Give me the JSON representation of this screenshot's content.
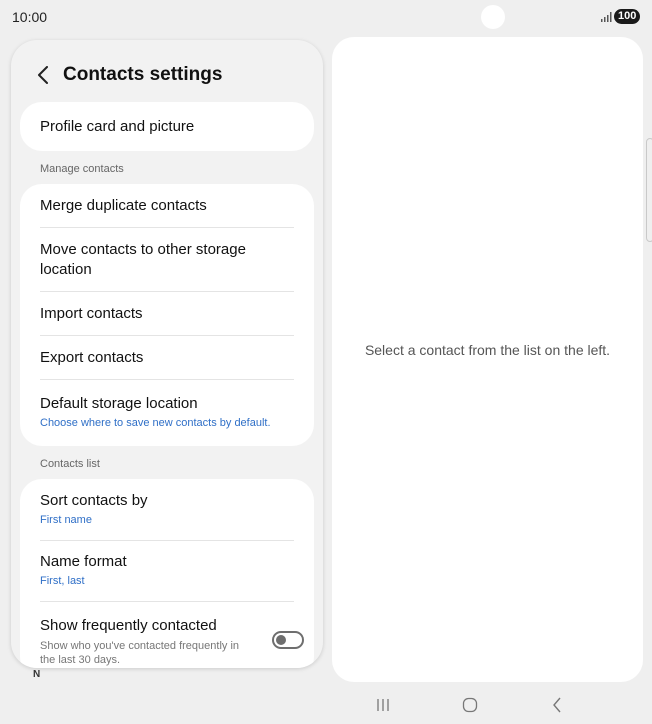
{
  "status_bar": {
    "time": "10:00",
    "battery": "100",
    "signal_icon": "signal-bars-icon"
  },
  "header": {
    "title": "Contacts settings",
    "back_icon": "chevron-left-icon"
  },
  "profile_card": {
    "label": "Profile card and picture"
  },
  "manage_contacts": {
    "section_label": "Manage contacts",
    "items": [
      {
        "label": "Merge duplicate contacts"
      },
      {
        "label": "Move contacts to other storage location"
      },
      {
        "label": "Import contacts"
      },
      {
        "label": "Export contacts"
      },
      {
        "label": "Default storage location",
        "sub": "Choose where to save new contacts by default."
      }
    ]
  },
  "contacts_list": {
    "section_label": "Contacts list",
    "items": [
      {
        "label": "Sort contacts by",
        "sub": "First name"
      },
      {
        "label": "Name format",
        "sub": "First, last"
      },
      {
        "label": "Show frequently contacted",
        "desc": "Show who you've contacted frequently in the last 30 days.",
        "toggle_on": false
      }
    ]
  },
  "bottom_letter": "N",
  "detail_pane": {
    "empty_message": "Select a contact from the list on the left."
  },
  "nav": {
    "recents_icon": "recents-icon",
    "home_icon": "home-icon",
    "back_icon": "back-icon"
  },
  "colors": {
    "accent_link": "#2f6fc7",
    "panel_bg": "#f2f2f2",
    "page_bg": "#efefef"
  }
}
